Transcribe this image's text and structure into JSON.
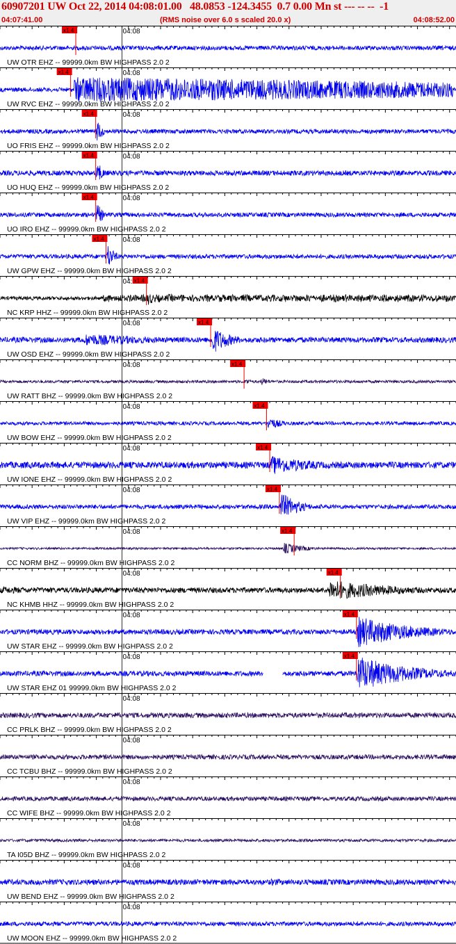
{
  "header": {
    "title": "60907201 UW Oct 22, 2014 04:08:01.00   48.0853 -124.3455  0.7 0.00 Mn st --- -- --  -1",
    "subtitle": "(RMS noise over 6.0 s scaled 20.0 x)",
    "start_time": "04:07:41.00",
    "end_time": "04:08:52.00"
  },
  "colors": {
    "blue_trace": "#0000ee",
    "black_trace": "#000000",
    "purple_trace": "#2a1060",
    "pick_marker": "#ee0000",
    "text": "#000000",
    "header_text": "#cc0000"
  },
  "chart_data": {
    "type": "line",
    "title": "60907201 UW Oct 22, 2014 04:08:01.00   48.0853 -124.3455  0.7 0.00 Mn st --- -- --  -1",
    "subtitle": "(RMS noise over 6.0 s scaled 20.0 x)",
    "x_start_label": "04:07:41.00",
    "x_end_label": "04:08:52.00",
    "xlim_seconds": [
      0,
      71
    ],
    "tick_label": "04:08",
    "tick_label_offset_seconds": 19,
    "pick_label": "x1.4",
    "series": [
      {
        "name": "UW OTR EHZ -- 99999.0km BW  HIGHPASS  2.0  2",
        "color": "blue",
        "pick_s": 11.8,
        "amplitude": 0.12,
        "events": [
          {
            "start_s": 11.8,
            "end_s": 13.5,
            "amp": 0.2
          }
        ]
      },
      {
        "name": "UW RVC EHZ -- 99999.0km BW  HIGHPASS  2.0  2",
        "color": "blue",
        "pick_s": 11.0,
        "amplitude": 0.12,
        "events": [
          {
            "start_s": 11.5,
            "end_s": 70.5,
            "amp": 0.7,
            "flat": true
          }
        ]
      },
      {
        "name": "UO FRIS EHZ -- 99999.0km BW  HIGHPASS  2.0  2",
        "color": "blue",
        "pick_s": 14.9,
        "amplitude": 0.12,
        "events": [
          {
            "start_s": 14.9,
            "end_s": 16.5,
            "amp": 0.9
          }
        ]
      },
      {
        "name": "UO HUQ EHZ -- 99999.0km BW  HIGHPASS  2.0  2",
        "color": "blue",
        "pick_s": 14.9,
        "amplitude": 0.14,
        "events": [
          {
            "start_s": 14.9,
            "end_s": 16.5,
            "amp": 0.9
          }
        ]
      },
      {
        "name": "UO IRO EHZ -- 99999.0km BW  HIGHPASS  2.0  2",
        "color": "blue",
        "pick_s": 14.9,
        "amplitude": 0.12,
        "events": [
          {
            "start_s": 14.9,
            "end_s": 16.5,
            "amp": 0.9
          }
        ]
      },
      {
        "name": "UW GPW EHZ -- 99999.0km BW  HIGHPASS  2.0  2",
        "color": "blue",
        "pick_s": 16.5,
        "amplitude": 0.12,
        "events": [
          {
            "start_s": 16.5,
            "end_s": 18.5,
            "amp": 0.9
          }
        ]
      },
      {
        "name": "NC KRP HHZ -- 99999.0km BW  HIGHPASS  2.0  2",
        "color": "black",
        "pick_s": 22.8,
        "amplitude": 0.1,
        "events": [
          {
            "start_s": 16.0,
            "end_s": 71.0,
            "amp": 0.22,
            "bursty": true
          },
          {
            "start_s": 22.8,
            "end_s": 25.5,
            "amp": 0.45
          }
        ]
      },
      {
        "name": "UW OSD EHZ -- 99999.0km BW  HIGHPASS  2.0  2",
        "color": "blue",
        "pick_s": 32.8,
        "amplitude": 0.15,
        "events": [
          {
            "start_s": 13.0,
            "end_s": 40.0,
            "amp": 0.35
          },
          {
            "start_s": 32.8,
            "end_s": 38.0,
            "amp": 0.85
          }
        ]
      },
      {
        "name": "UW RATT BHZ -- 99999.0km BW  HIGHPASS  2.0  2",
        "color": "purple",
        "pick_s": 38.0,
        "amplitude": 0.08,
        "events": [
          {
            "start_s": 38.0,
            "end_s": 39.5,
            "amp": 0.3
          },
          {
            "start_s": 40.5,
            "end_s": 43.5,
            "amp": 0.25
          },
          {
            "start_s": 52.0,
            "end_s": 53.0,
            "amp": 0.2
          }
        ]
      },
      {
        "name": "UW BOW EHZ -- 99999.0km BW  HIGHPASS  2.0  2",
        "color": "blue",
        "pick_s": 41.5,
        "amplitude": 0.1,
        "events": [
          {
            "start_s": 41.5,
            "end_s": 46.0,
            "amp": 0.4
          }
        ]
      },
      {
        "name": "UW IONE EHZ -- 99999.0km BW  HIGHPASS  2.0  2",
        "color": "blue",
        "pick_s": 42.0,
        "amplitude": 0.18,
        "events": [
          {
            "start_s": 42.0,
            "end_s": 56.0,
            "amp": 0.55
          }
        ]
      },
      {
        "name": "UW VIP EHZ -- 99999.0km BW  HIGHPASS  2.0  2",
        "color": "blue",
        "pick_s": 43.5,
        "amplitude": 0.12,
        "events": [
          {
            "start_s": 43.5,
            "end_s": 48.5,
            "amp": 0.9
          }
        ]
      },
      {
        "name": "CC NORM BHZ -- 99999.0km BW  HIGHPASS  2.0  2",
        "color": "purple",
        "pick_s": 45.8,
        "amplitude": 0.06,
        "events": [
          {
            "start_s": 44.0,
            "end_s": 50.0,
            "amp": 0.35
          }
        ]
      },
      {
        "name": "NC KHMB HHZ -- 99999.0km BW  HIGHPASS  2.0  2",
        "color": "black",
        "pick_s": 53.0,
        "amplitude": 0.15,
        "events": [
          {
            "start_s": 0.0,
            "end_s": 30.0,
            "amp": 0.2
          },
          {
            "start_s": 51.0,
            "end_s": 71.0,
            "amp": 0.6
          }
        ]
      },
      {
        "name": "UW STAR EHZ -- 99999.0km BW  HIGHPASS  2.0  2",
        "color": "blue",
        "pick_s": 55.5,
        "amplitude": 0.14,
        "events": [
          {
            "start_s": 55.5,
            "end_s": 71.0,
            "amp": 0.9
          }
        ]
      },
      {
        "name": "UW STAR EHZ 01 99999.0km BW  HIGHPASS  2.0  2",
        "color": "blue",
        "pick_s": 55.5,
        "amplitude": 0.14,
        "gap": [
          41.0,
          44.0
        ],
        "events": [
          {
            "start_s": 55.5,
            "end_s": 71.0,
            "amp": 1.0
          }
        ]
      },
      {
        "name": "CC PRLK BHZ -- 99999.0km BW  HIGHPASS  2.0  2",
        "color": "purple",
        "amplitude": 0.14,
        "events": []
      },
      {
        "name": "CC TCBU BHZ -- 99999.0km BW  HIGHPASS  2.0  2",
        "color": "purple",
        "amplitude": 0.13,
        "events": [
          {
            "start_s": 19.0,
            "end_s": 20.0,
            "amp": 0.25
          }
        ]
      },
      {
        "name": "CC WIFE BHZ -- 99999.0km BW  HIGHPASS  2.0  2",
        "color": "purple",
        "amplitude": 0.12,
        "events": []
      },
      {
        "name": "TA I05D BHZ -- 99999.0km BW  HIGHPASS  2.0  2",
        "color": "purple",
        "amplitude": 0.08,
        "events": []
      },
      {
        "name": "UW BEND EHZ -- 99999.0km BW  HIGHPASS  2.0  2",
        "color": "blue",
        "amplitude": 0.15,
        "events": [
          {
            "start_s": 42.0,
            "end_s": 52.0,
            "amp": 0.22
          }
        ]
      },
      {
        "name": "UW MOON EHZ -- 99999.0km BW  HIGHPASS  2.0  2",
        "color": "blue",
        "amplitude": 0.12,
        "events": []
      }
    ]
  }
}
